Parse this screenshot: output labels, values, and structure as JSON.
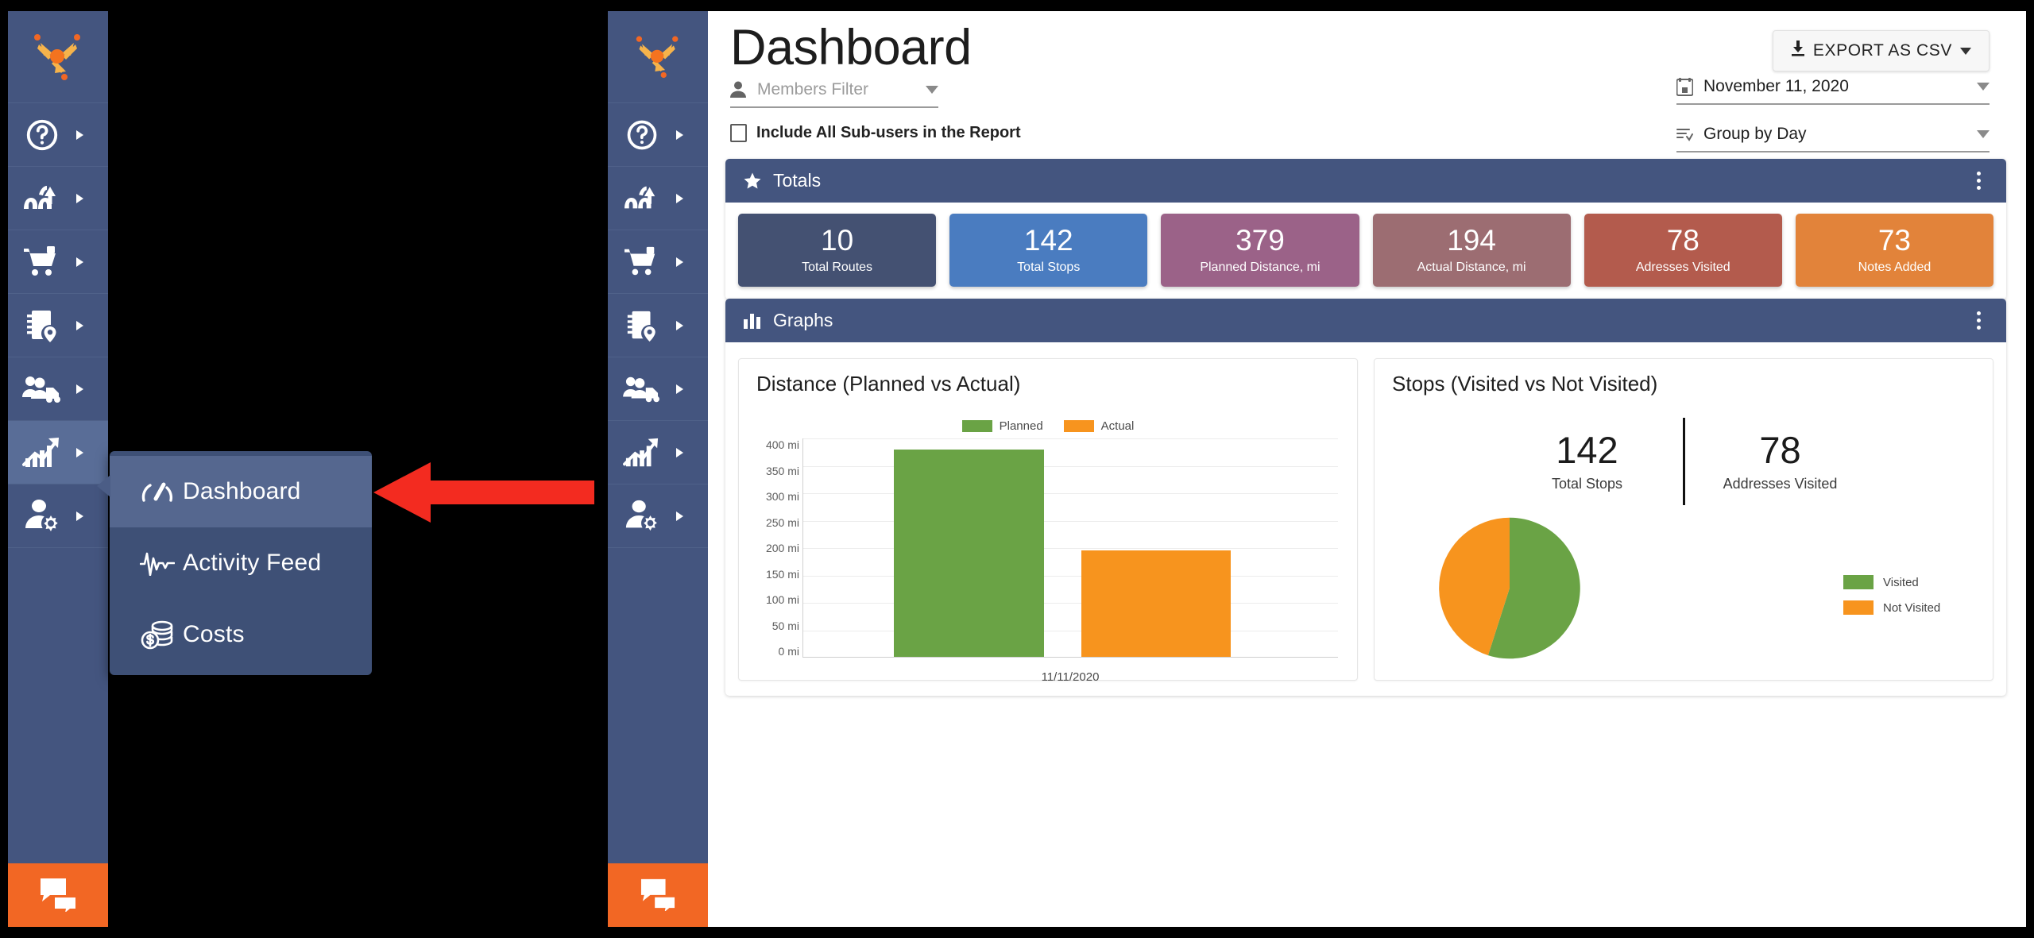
{
  "app": {
    "brand_icon": "route-arrows-logo",
    "sidebar_bg": "#44557f",
    "accent_orange": "#f26724"
  },
  "sidebar": {
    "logo_name": "route4me-logo",
    "items": [
      {
        "icon": "question-circle-icon",
        "name": "help",
        "active": false
      },
      {
        "icon": "route-optimization-icon",
        "name": "routes",
        "active": false
      },
      {
        "icon": "shopping-cart-icon",
        "name": "orders",
        "active": false
      },
      {
        "icon": "address-book-pin-icon",
        "name": "address-book",
        "active": false
      },
      {
        "icon": "team-vehicle-icon",
        "name": "team-and-fleet",
        "active": false
      },
      {
        "icon": "growth-chart-icon",
        "name": "reports",
        "active": true
      },
      {
        "icon": "user-gear-icon",
        "name": "account-settings",
        "active": false
      }
    ],
    "chat_icon": "chat-bubbles-icon"
  },
  "flyout": {
    "items": [
      {
        "label": "Dashboard",
        "icon": "speedometer-icon",
        "active": true
      },
      {
        "label": "Activity Feed",
        "icon": "pulse-wave-icon",
        "active": false
      },
      {
        "label": "Costs",
        "icon": "coins-dollar-icon",
        "active": false
      }
    ]
  },
  "annotation": {
    "arrow": "red-left-arrow",
    "color": "#f32b20"
  },
  "header": {
    "title": "Dashboard",
    "export_button": {
      "label": "EXPORT AS CSV",
      "icon": "download-icon",
      "caret": "chevron-down-icon"
    }
  },
  "filters": {
    "members": {
      "placeholder": "Members Filter",
      "value": "",
      "icon": "person-icon"
    },
    "subusers_checkbox": {
      "label": "Include All Sub-users in the Report",
      "checked": false
    },
    "date": {
      "value": "November 11, 2020",
      "icon": "calendar-icon"
    },
    "group_by": {
      "value": "Group by Day",
      "icon": "sort-list-icon"
    }
  },
  "totals_panel": {
    "title": "Totals",
    "icon": "star-icon",
    "menu_icon": "kebab-menu-icon",
    "cards": [
      {
        "value": "10",
        "label": "Total Routes",
        "color": "#445172"
      },
      {
        "value": "142",
        "label": "Total Stops",
        "color": "#4a7cc0"
      },
      {
        "value": "379",
        "label": "Planned Distance, mi",
        "color": "#9b6288"
      },
      {
        "value": "194",
        "label": "Actual Distance, mi",
        "color": "#9c6d72"
      },
      {
        "value": "78",
        "label": "Adresses Visited",
        "color": "#b35b4d"
      },
      {
        "value": "73",
        "label": "Notes Added",
        "color": "#e2833a"
      }
    ]
  },
  "graphs_panel": {
    "title": "Graphs",
    "icon": "bar-chart-icon",
    "menu_icon": "kebab-menu-icon"
  },
  "chart_data": [
    {
      "type": "bar",
      "title": "Distance (Planned vs Actual)",
      "categories": [
        "11/11/2020"
      ],
      "series": [
        {
          "name": "Planned",
          "values": [
            379
          ],
          "color": "#6aa345"
        },
        {
          "name": "Actual",
          "values": [
            194
          ],
          "color": "#f7941e"
        }
      ],
      "xlabel": "",
      "ylabel": "",
      "ylim": [
        0,
        400
      ],
      "yticks": [
        "400 mi",
        "350 mi",
        "300 mi",
        "250 mi",
        "200 mi",
        "150 mi",
        "100 mi",
        "50 mi",
        "0 mi"
      ],
      "grid": true,
      "legend_position": "top-center"
    },
    {
      "type": "pie",
      "title": "Stops (Visited vs Not Visited)",
      "kpis": [
        {
          "value": "142",
          "label": "Total Stops"
        },
        {
          "value": "78",
          "label": "Addresses Visited"
        }
      ],
      "labels": [
        "Visited",
        "Not Visited"
      ],
      "values": [
        78,
        64
      ],
      "percentages": [
        55,
        45
      ],
      "colors": [
        "#6aa345",
        "#f7941e"
      ],
      "legend_position": "right"
    }
  ]
}
